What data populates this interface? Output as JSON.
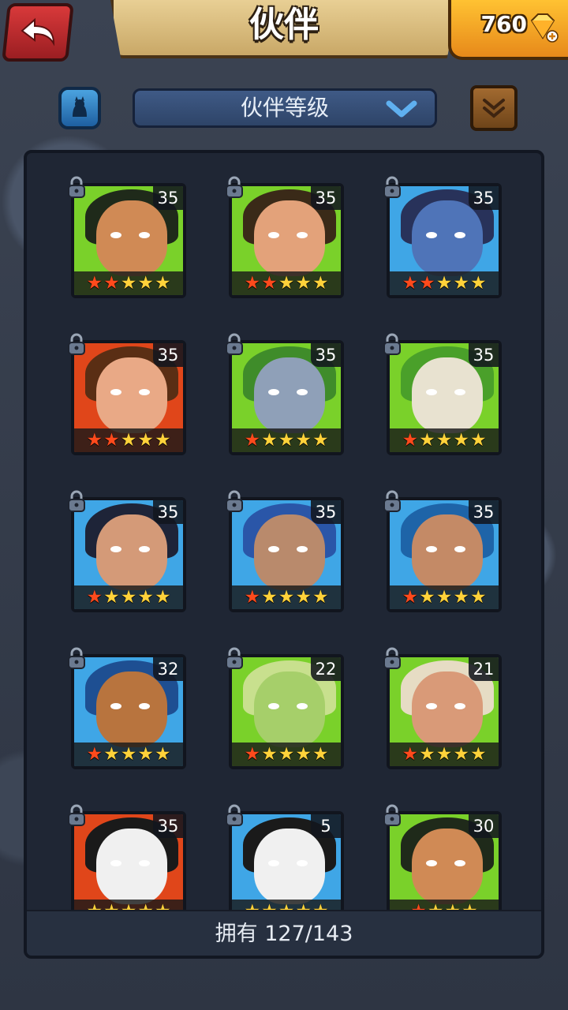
{
  "header": {
    "title": "伙伴",
    "gem_count": "760"
  },
  "filter": {
    "sort_label": "伙伴等级"
  },
  "footer": {
    "owned": "拥有 127/143"
  },
  "colors": {
    "red_star": "#ff4a1c",
    "gold_star": "#ffd23a"
  },
  "companions": [
    {
      "level": "35",
      "stars_total": 5,
      "red_stars": 2,
      "bg": "#7ad12a",
      "skin": "#d08a55",
      "hair": "#1f2a1a"
    },
    {
      "level": "35",
      "stars_total": 5,
      "red_stars": 2,
      "bg": "#7ad12a",
      "skin": "#e3a27a",
      "hair": "#3a2a18"
    },
    {
      "level": "35",
      "stars_total": 5,
      "red_stars": 2,
      "bg": "#3fa6e6",
      "skin": "#4f74b8",
      "hair": "#28325a"
    },
    {
      "level": "35",
      "stars_total": 5,
      "red_stars": 2,
      "bg": "#e0461a",
      "skin": "#e9a986",
      "hair": "#5a2e14"
    },
    {
      "level": "35",
      "stars_total": 5,
      "red_stars": 1,
      "bg": "#7ad12a",
      "skin": "#8fa0b8",
      "hair": "#3f8c2a"
    },
    {
      "level": "35",
      "stars_total": 5,
      "red_stars": 1,
      "bg": "#7ad12a",
      "skin": "#e8e2d0",
      "hair": "#4aa02a"
    },
    {
      "level": "35",
      "stars_total": 5,
      "red_stars": 1,
      "bg": "#3fa6e6",
      "skin": "#d49a78",
      "hair": "#1e2438"
    },
    {
      "level": "35",
      "stars_total": 5,
      "red_stars": 1,
      "bg": "#3fa6e6",
      "skin": "#b98a6c",
      "hair": "#2a56a8"
    },
    {
      "level": "35",
      "stars_total": 5,
      "red_stars": 1,
      "bg": "#3fa6e6",
      "skin": "#c48a66",
      "hair": "#1e64a8"
    },
    {
      "level": "32",
      "stars_total": 5,
      "red_stars": 1,
      "bg": "#3fa6e6",
      "skin": "#b8743e",
      "hair": "#1e4f92"
    },
    {
      "level": "22",
      "stars_total": 5,
      "red_stars": 1,
      "bg": "#7ad12a",
      "skin": "#a6cf6a",
      "hair": "#c8e08e"
    },
    {
      "level": "21",
      "stars_total": 5,
      "red_stars": 1,
      "bg": "#7ad12a",
      "skin": "#d99a78",
      "hair": "#e6dcc4"
    },
    {
      "level": "35",
      "stars_total": 5,
      "red_stars": 0,
      "bg": "#e0461a",
      "skin": "#f0f0f0",
      "hair": "#1a1a1a"
    },
    {
      "level": "5",
      "stars_total": 5,
      "red_stars": 0,
      "bg": "#3fa6e6",
      "skin": "#f0f0f0",
      "hair": "#1a1a1a"
    },
    {
      "level": "30",
      "stars_total": 4,
      "red_stars": 1,
      "bg": "#7ad12a",
      "skin": "#d08a55",
      "hair": "#1f2a1a"
    }
  ]
}
